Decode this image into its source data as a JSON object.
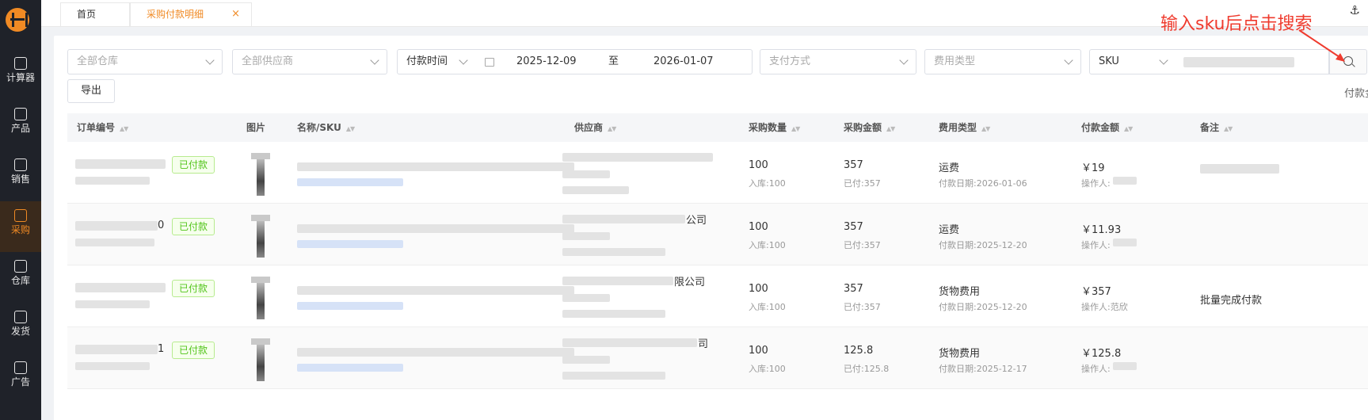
{
  "tabs": [
    {
      "label": "首页"
    },
    {
      "label": "采购付款明细",
      "close": "×"
    }
  ],
  "anchor_icon": "⚓",
  "sidebar": {
    "items": [
      {
        "label": "计算器",
        "icon": "calculator-icon"
      },
      {
        "label": "产品",
        "icon": "product-icon"
      },
      {
        "label": "销售",
        "icon": "sales-icon"
      },
      {
        "label": "采购",
        "icon": "purchase-icon",
        "active": true
      },
      {
        "label": "仓库",
        "icon": "warehouse-icon"
      },
      {
        "label": "发货",
        "icon": "shipping-icon"
      },
      {
        "label": "广告",
        "icon": "ad-icon"
      }
    ]
  },
  "filters": {
    "warehouse": "全部仓库",
    "supplier": "全部供应商",
    "time_type": "付款时间",
    "date_from": "2025-12-09",
    "date_sep": "至",
    "date_to": "2026-01-07",
    "pay_method": "支付方式",
    "fee_type": "费用类型",
    "sku_type": "SKU"
  },
  "export_label": "导出",
  "pay_total_label": "付款金",
  "annotation": "输入sku后点击搜索",
  "columns": [
    "订单编号",
    "图片",
    "名称/SKU",
    "供应商",
    "采购数量",
    "采购金额",
    "费用类型",
    "付款金额",
    "备注"
  ],
  "rows": [
    {
      "order_tail": "",
      "status": "已付款",
      "supplier_tail": "",
      "qty": "100",
      "qty_sub": "入库:100",
      "amount": "357",
      "amount_sub": "已付:357",
      "fee": "运费",
      "fee_sub": "付款日期:2026-01-06",
      "pay": "￥19",
      "pay_sub": "操作人:",
      "note": ""
    },
    {
      "order_tail": "0",
      "status": "已付款",
      "supplier_tail": "公司",
      "qty": "100",
      "qty_sub": "入库:100",
      "amount": "357",
      "amount_sub": "已付:357",
      "fee": "运费",
      "fee_sub": "付款日期:2025-12-20",
      "pay": "￥11.93",
      "pay_sub": "操作人:",
      "note": ""
    },
    {
      "order_tail": "",
      "status": "已付款",
      "supplier_tail": "限公司",
      "qty": "100",
      "qty_sub": "入库:100",
      "amount": "357",
      "amount_sub": "已付:357",
      "fee": "货物费用",
      "fee_sub": "付款日期:2025-12-20",
      "pay": "￥357",
      "pay_sub": "操作人:范欣",
      "note": "批量完成付款"
    },
    {
      "order_tail": "1",
      "status": "已付款",
      "supplier_tail": "司",
      "qty": "100",
      "qty_sub": "入库:100",
      "amount": "125.8",
      "amount_sub": "已付:125.8",
      "fee": "货物费用",
      "fee_sub": "付款日期:2025-12-17",
      "pay": "￥125.8",
      "pay_sub": "操作人:",
      "note": ""
    }
  ]
}
